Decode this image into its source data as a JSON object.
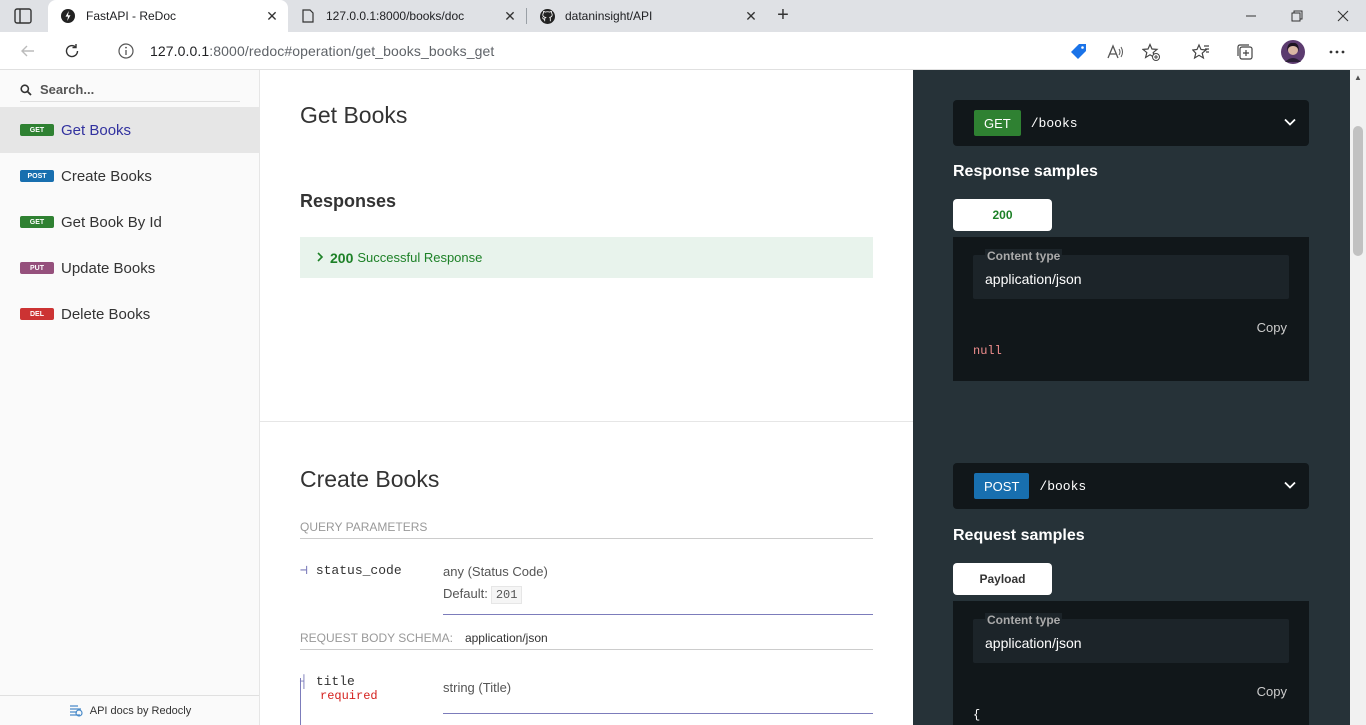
{
  "browser": {
    "tabs": [
      {
        "title": "FastAPI - ReDoc",
        "active": true
      },
      {
        "title": "127.0.0.1:8000/books/doc",
        "active": false
      },
      {
        "title": "dataninsight/API",
        "active": false
      }
    ],
    "url_host": "127.0.0.1",
    "url_rest": ":8000/redoc#operation/get_books_books_get"
  },
  "menu": {
    "search_placeholder": "Search...",
    "items": [
      {
        "method": "get",
        "label": "Get Books",
        "color": "#2f8132"
      },
      {
        "method": "post",
        "label": "Create Books",
        "color": "#186fAF"
      },
      {
        "method": "get",
        "label": "Get Book By Id",
        "color": "#2f8132"
      },
      {
        "method": "put",
        "label": "Update Books",
        "color": "#95507c"
      },
      {
        "method": "del",
        "label": "Delete Books",
        "color": "#cc3333"
      }
    ],
    "footer": "API docs by Redocly"
  },
  "get_books": {
    "title": "Get Books",
    "responses_heading": "Responses",
    "response_code": "200",
    "response_desc": "Successful Response"
  },
  "create_books": {
    "title": "Create Books",
    "query_params_header": "QUERY PARAMETERS",
    "param_name": "status_code",
    "param_type": "any (Status Code)",
    "default_label": "Default:",
    "default_value": "201",
    "body_schema_header": "REQUEST BODY SCHEMA:",
    "body_mime": "application/json",
    "field_name": "title",
    "field_required": "required",
    "field_type": "string (Title)"
  },
  "right": {
    "get": {
      "method": "GET",
      "path": "/books",
      "samples_title": "Response samples",
      "tab": "200",
      "content_type_label": "Content type",
      "content_type": "application/json",
      "copy": "Copy",
      "code": "null"
    },
    "post": {
      "method": "POST",
      "path": "/books",
      "samples_title": "Request samples",
      "tab": "Payload",
      "content_type_label": "Content type",
      "content_type": "application/json",
      "copy": "Copy",
      "code": "{"
    }
  },
  "colors": {
    "get": "#2f8132",
    "post": "#186faf",
    "put": "#95507c",
    "del": "#cc3333",
    "accent": "#32329f"
  }
}
